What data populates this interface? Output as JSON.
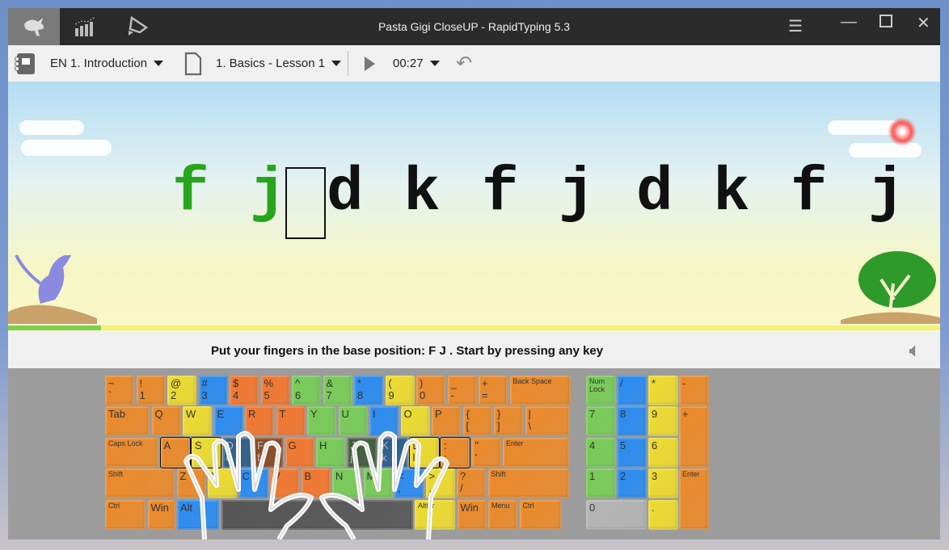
{
  "window": {
    "title": "Pasta Gigi CloseUP - RapidTyping 5.3"
  },
  "titlebar": {
    "tabs": [
      {
        "icon": "rabbit-icon",
        "active": true
      },
      {
        "icon": "statistics-icon",
        "active": false
      },
      {
        "icon": "editor-icon",
        "active": false
      }
    ],
    "controls": [
      "menu-icon",
      "minimize-icon",
      "maximize-icon",
      "close-icon"
    ]
  },
  "toolbar": {
    "course": "EN 1. Introduction",
    "lesson": "1. Basics - Lesson 1",
    "time": "00:27"
  },
  "exercise": {
    "typed": [
      "f",
      "j"
    ],
    "remaining": [
      "d",
      "k",
      "f",
      "j",
      "d",
      "k",
      "f",
      "j"
    ],
    "progress": 0.1
  },
  "status": {
    "message": "Put your fingers in the base position:  F  J .  Start by pressing any key"
  },
  "colors": {
    "O": "#ec8a2a",
    "R": "#f3772e",
    "Y": "#eedc2e",
    "B": "#2a8cf2",
    "G": "#78cc57",
    "DB": "#2a5d8c",
    "BR": "#8a4a22",
    "DG": "#3f5c38",
    "S": "#555555",
    "GR": "#b5b5b5"
  },
  "keyboard": {
    "rows": [
      [
        [
          "~",
          "`",
          "O"
        ],
        [
          "!",
          "1",
          "O"
        ],
        [
          "@",
          "2",
          "Y"
        ],
        [
          "#",
          "3",
          "B"
        ],
        [
          "$",
          "4",
          "R"
        ],
        [
          "%",
          "5",
          "R"
        ],
        [
          "^",
          "6",
          "G"
        ],
        [
          "&",
          "7",
          "G"
        ],
        [
          "*",
          "8",
          "B"
        ],
        [
          "(",
          "9",
          "Y"
        ],
        [
          ")",
          "0",
          "O"
        ],
        [
          "_",
          "-",
          "O"
        ],
        [
          "+",
          "=",
          "O"
        ],
        [
          "Back Space",
          "",
          "O"
        ]
      ],
      [
        [
          "Tab",
          "",
          "O"
        ],
        [
          "Q",
          "",
          "O"
        ],
        [
          "W",
          "",
          "Y"
        ],
        [
          "E",
          "",
          "B"
        ],
        [
          "R",
          "",
          "R"
        ],
        [
          "T",
          "",
          "R"
        ],
        [
          "Y",
          "",
          "G"
        ],
        [
          "U",
          "",
          "G"
        ],
        [
          "I",
          "",
          "B"
        ],
        [
          "O",
          "",
          "Y"
        ],
        [
          "P",
          "",
          "O"
        ],
        [
          "{",
          "[",
          "O"
        ],
        [
          "}",
          "]",
          "O"
        ],
        [
          "|",
          "\\",
          "O"
        ]
      ],
      [
        [
          "Caps Lock",
          "",
          "O"
        ],
        [
          "A",
          "",
          "O"
        ],
        [
          "S",
          "",
          "Y"
        ],
        [
          "D",
          "d",
          "DB"
        ],
        [
          "F",
          "f",
          "BR"
        ],
        [
          "G",
          "",
          "R"
        ],
        [
          "H",
          "",
          "G"
        ],
        [
          "J",
          "j",
          "DG"
        ],
        [
          "K",
          "k",
          "DB"
        ],
        [
          "L",
          "l",
          "Y"
        ],
        [
          ":",
          ";",
          "O"
        ],
        [
          "\"",
          "'",
          "O"
        ],
        [
          "Enter",
          "",
          "O"
        ]
      ],
      [
        [
          "Shift",
          "",
          "O"
        ],
        [
          "Z",
          "",
          "O"
        ],
        [
          "X",
          "",
          "Y"
        ],
        [
          "C",
          "",
          "B"
        ],
        [
          "V",
          "",
          "R"
        ],
        [
          "B",
          "",
          "R"
        ],
        [
          "N",
          "",
          "G"
        ],
        [
          "M",
          "",
          "G"
        ],
        [
          "<",
          ",",
          "B"
        ],
        [
          ">",
          ".",
          "Y"
        ],
        [
          "?",
          "/",
          "O"
        ],
        [
          "Shift",
          "",
          "O"
        ]
      ],
      [
        [
          "Ctrl",
          "",
          "O"
        ],
        [
          "Win",
          "",
          "O"
        ],
        [
          "Alt",
          "",
          "B"
        ],
        [
          "",
          "",
          "S"
        ],
        [
          "AltGr",
          "",
          "Y"
        ],
        [
          "Win",
          "",
          "O"
        ],
        [
          "Menu",
          "",
          "O"
        ],
        [
          "Ctrl",
          "",
          "O"
        ]
      ]
    ],
    "numpad": [
      [
        "Num Lock",
        "G"
      ],
      [
        "/",
        "B"
      ],
      [
        "*",
        "Y"
      ],
      [
        "-",
        "O"
      ],
      [
        "7",
        "G"
      ],
      [
        "8",
        "B"
      ],
      [
        "9",
        "Y"
      ],
      [
        "+",
        "O"
      ],
      [
        "4",
        "G"
      ],
      [
        "5",
        "B"
      ],
      [
        "6",
        "Y"
      ],
      [
        "1",
        "G"
      ],
      [
        "2",
        "B"
      ],
      [
        "3",
        "Y"
      ],
      [
        "Enter",
        "O"
      ],
      [
        "0",
        "GR"
      ],
      [
        ".",
        "Y"
      ]
    ]
  }
}
